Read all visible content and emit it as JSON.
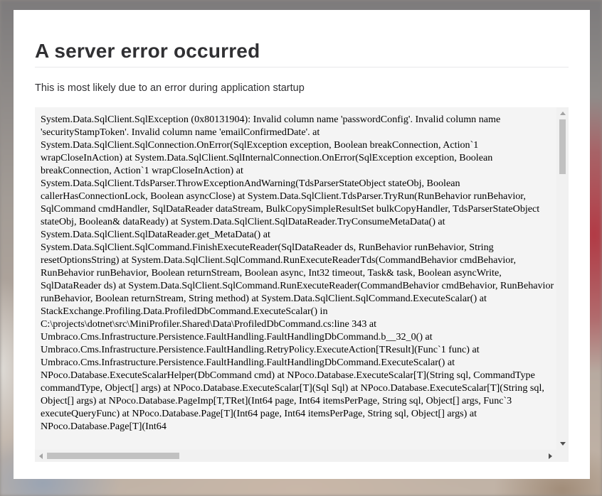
{
  "page": {
    "title": "A server error occurred",
    "subtitle": "This is most likely due to an error during application startup",
    "error_details": "System.Data.SqlClient.SqlException (0x80131904): Invalid column name 'passwordConfig'. Invalid column name 'securityStampToken'. Invalid column name 'emailConfirmedDate'. at System.Data.SqlClient.SqlConnection.OnError(SqlException exception, Boolean breakConnection, Action`1 wrapCloseInAction) at System.Data.SqlClient.SqlInternalConnection.OnError(SqlException exception, Boolean breakConnection, Action`1 wrapCloseInAction) at System.Data.SqlClient.TdsParser.ThrowExceptionAndWarning(TdsParserStateObject stateObj, Boolean callerHasConnectionLock, Boolean asyncClose) at System.Data.SqlClient.TdsParser.TryRun(RunBehavior runBehavior, SqlCommand cmdHandler, SqlDataReader dataStream, BulkCopySimpleResultSet bulkCopyHandler, TdsParserStateObject stateObj, Boolean& dataReady) at System.Data.SqlClient.SqlDataReader.TryConsumeMetaData() at System.Data.SqlClient.SqlDataReader.get_MetaData() at System.Data.SqlClient.SqlCommand.FinishExecuteReader(SqlDataReader ds, RunBehavior runBehavior, String resetOptionsString) at System.Data.SqlClient.SqlCommand.RunExecuteReaderTds(CommandBehavior cmdBehavior, RunBehavior runBehavior, Boolean returnStream, Boolean async, Int32 timeout, Task& task, Boolean asyncWrite, SqlDataReader ds) at System.Data.SqlClient.SqlCommand.RunExecuteReader(CommandBehavior cmdBehavior, RunBehavior runBehavior, Boolean returnStream, String method) at System.Data.SqlClient.SqlCommand.ExecuteScalar() at StackExchange.Profiling.Data.ProfiledDbCommand.ExecuteScalar() in C:\\projects\\dotnet\\src\\MiniProfiler.Shared\\Data\\ProfiledDbCommand.cs:line 343 at Umbraco.Cms.Infrastructure.Persistence.FaultHandling.FaultHandlingDbCommand.b__32_0() at Umbraco.Cms.Infrastructure.Persistence.FaultHandling.RetryPolicy.ExecuteAction[TResult](Func`1 func) at Umbraco.Cms.Infrastructure.Persistence.FaultHandling.FaultHandlingDbCommand.ExecuteScalar() at NPoco.Database.ExecuteScalarHelper(DbCommand cmd) at NPoco.Database.ExecuteScalar[T](String sql, CommandType commandType, Object[] args) at NPoco.Database.ExecuteScalar[T](Sql Sql) at NPoco.Database.ExecuteScalar[T](String sql, Object[] args) at NPoco.Database.PageImp[T,TRet](Int64 page, Int64 itemsPerPage, String sql, Object[] args, Func`3 executeQueryFunc) at NPoco.Database.Page[T](Int64 page, Int64 itemsPerPage, String sql, Object[] args) at NPoco.Database.Page[T](Int64"
  },
  "colors": {
    "card_background": "#ffffff",
    "title_text": "#303033",
    "error_box_background": "#f4f4f4",
    "scrollbar_thumb": "#c1c1c1"
  },
  "scroll": {
    "vertical_position_fraction": 0.0,
    "horizontal_position_fraction": 0.0
  }
}
